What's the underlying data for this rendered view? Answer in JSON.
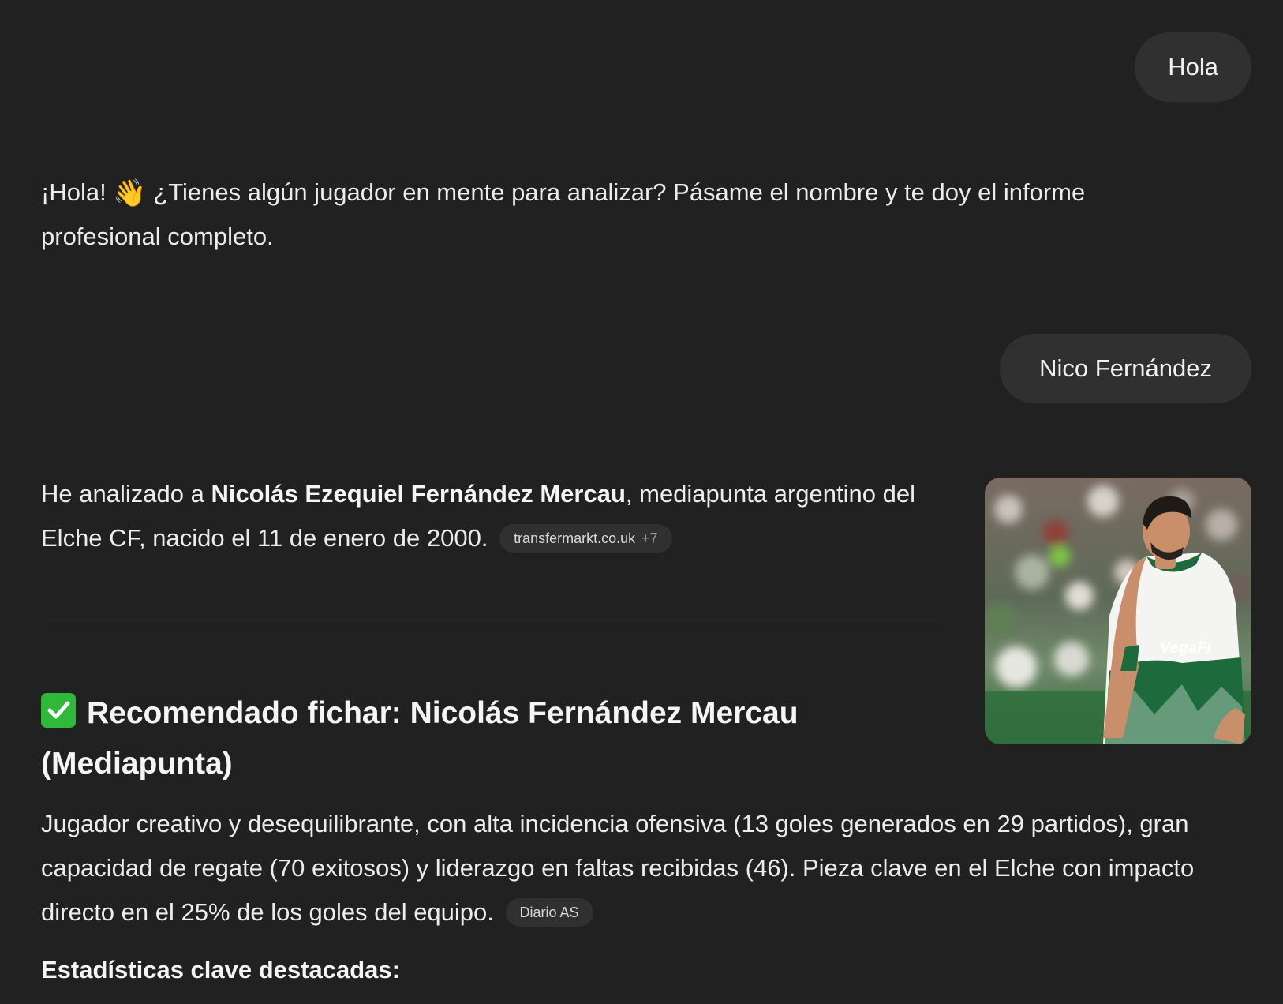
{
  "conversation": {
    "user_message_1": "Hola",
    "assistant_greeting": {
      "text_before_emoji": "¡Hola! ",
      "emoji": "👋",
      "text_after_emoji": " ¿Tienes algún jugador en mente para analizar? Pásame el nombre y te doy el informe profesional completo."
    },
    "user_message_2": "Nico Fernández",
    "assistant_analysis": {
      "intro": "He analizado a ",
      "player_name": "Nicolás Ezequiel Fernández Mercau",
      "rest": ", mediapunta argentino del Elche CF, nacido el 11 de enero de 2000.",
      "source": {
        "label": "transfermarkt.co.uk",
        "count": "+7"
      }
    },
    "recommendation": {
      "icon": "check-mark-icon",
      "heading": "Recomendado fichar: Nicolás Fernández Mercau (Mediapunta)",
      "body": "Jugador creativo y desequilibrante, con alta incidencia ofensiva (13 goles generados en 29 partidos), gran capacidad de regate (70 exitosos) y liderazgo en faltas recibidas (46). Pieza clave en el Elche con impacto directo en el 25% de los goles del equipo.",
      "source": {
        "label": "Diario AS"
      }
    },
    "key_stats_heading": "Estadísticas clave destacadas:",
    "player_photo": {
      "alt": "Nicolás Fernández Mercau",
      "shirt_sponsor": "VegaFi"
    }
  },
  "colors": {
    "background": "#212121",
    "bubble": "#303030",
    "text": "#ececec",
    "check_green": "#2fb83a",
    "jersey_green": "#1d6b3d"
  }
}
